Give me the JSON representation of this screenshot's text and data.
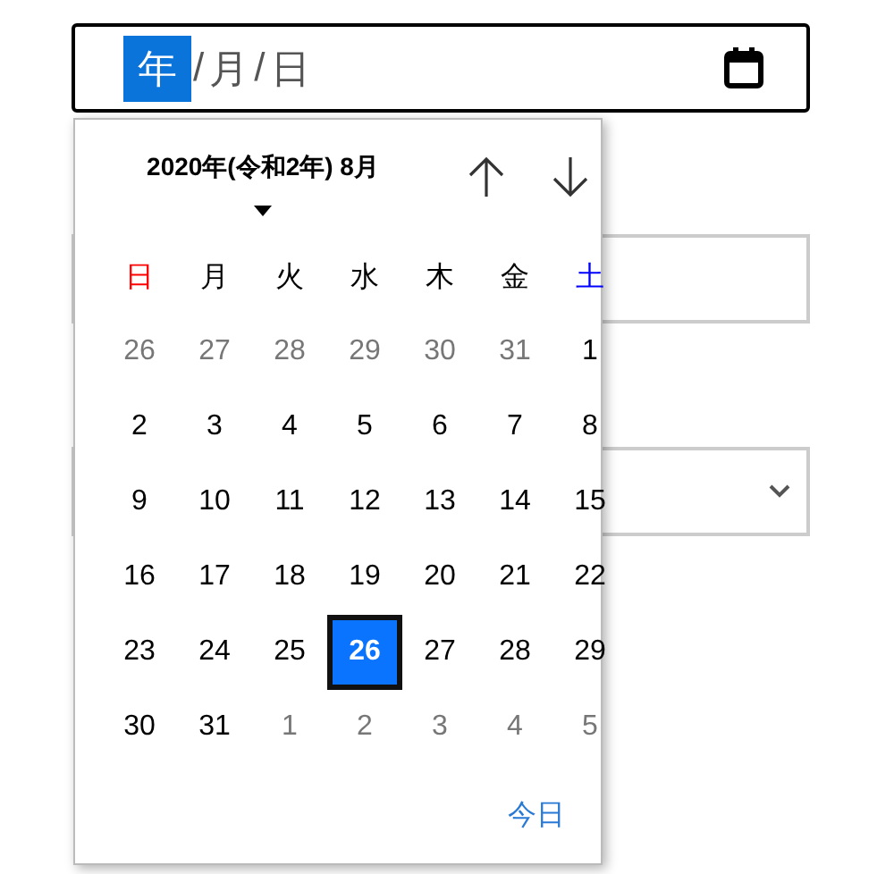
{
  "date_field": {
    "separator": "/",
    "segments": [
      {
        "text": "年",
        "selected": true
      },
      {
        "text": "月",
        "selected": false
      },
      {
        "text": "日",
        "selected": false
      }
    ]
  },
  "calendar": {
    "title": "2020年(令和2年) 8月",
    "weekdays": [
      {
        "label": "日",
        "kind": "sunday"
      },
      {
        "label": "月",
        "kind": "weekday"
      },
      {
        "label": "火",
        "kind": "weekday"
      },
      {
        "label": "水",
        "kind": "weekday"
      },
      {
        "label": "木",
        "kind": "weekday"
      },
      {
        "label": "金",
        "kind": "weekday"
      },
      {
        "label": "土",
        "kind": "saturday"
      }
    ],
    "weeks": [
      [
        {
          "day": "26",
          "outside": true,
          "selected": false
        },
        {
          "day": "27",
          "outside": true,
          "selected": false
        },
        {
          "day": "28",
          "outside": true,
          "selected": false
        },
        {
          "day": "29",
          "outside": true,
          "selected": false
        },
        {
          "day": "30",
          "outside": true,
          "selected": false
        },
        {
          "day": "31",
          "outside": true,
          "selected": false
        },
        {
          "day": "1",
          "outside": false,
          "selected": false
        }
      ],
      [
        {
          "day": "2",
          "outside": false,
          "selected": false
        },
        {
          "day": "3",
          "outside": false,
          "selected": false
        },
        {
          "day": "4",
          "outside": false,
          "selected": false
        },
        {
          "day": "5",
          "outside": false,
          "selected": false
        },
        {
          "day": "6",
          "outside": false,
          "selected": false
        },
        {
          "day": "7",
          "outside": false,
          "selected": false
        },
        {
          "day": "8",
          "outside": false,
          "selected": false
        }
      ],
      [
        {
          "day": "9",
          "outside": false,
          "selected": false
        },
        {
          "day": "10",
          "outside": false,
          "selected": false
        },
        {
          "day": "11",
          "outside": false,
          "selected": false
        },
        {
          "day": "12",
          "outside": false,
          "selected": false
        },
        {
          "day": "13",
          "outside": false,
          "selected": false
        },
        {
          "day": "14",
          "outside": false,
          "selected": false
        },
        {
          "day": "15",
          "outside": false,
          "selected": false
        }
      ],
      [
        {
          "day": "16",
          "outside": false,
          "selected": false
        },
        {
          "day": "17",
          "outside": false,
          "selected": false
        },
        {
          "day": "18",
          "outside": false,
          "selected": false
        },
        {
          "day": "19",
          "outside": false,
          "selected": false
        },
        {
          "day": "20",
          "outside": false,
          "selected": false
        },
        {
          "day": "21",
          "outside": false,
          "selected": false
        },
        {
          "day": "22",
          "outside": false,
          "selected": false
        }
      ],
      [
        {
          "day": "23",
          "outside": false,
          "selected": false
        },
        {
          "day": "24",
          "outside": false,
          "selected": false
        },
        {
          "day": "25",
          "outside": false,
          "selected": false
        },
        {
          "day": "26",
          "outside": false,
          "selected": true
        },
        {
          "day": "27",
          "outside": false,
          "selected": false
        },
        {
          "day": "28",
          "outside": false,
          "selected": false
        },
        {
          "day": "29",
          "outside": false,
          "selected": false
        }
      ],
      [
        {
          "day": "30",
          "outside": false,
          "selected": false
        },
        {
          "day": "31",
          "outside": false,
          "selected": false
        },
        {
          "day": "1",
          "outside": true,
          "selected": false
        },
        {
          "day": "2",
          "outside": true,
          "selected": false
        },
        {
          "day": "3",
          "outside": true,
          "selected": false
        },
        {
          "day": "4",
          "outside": true,
          "selected": false
        },
        {
          "day": "5",
          "outside": true,
          "selected": false
        }
      ]
    ],
    "today_button": "今日"
  }
}
